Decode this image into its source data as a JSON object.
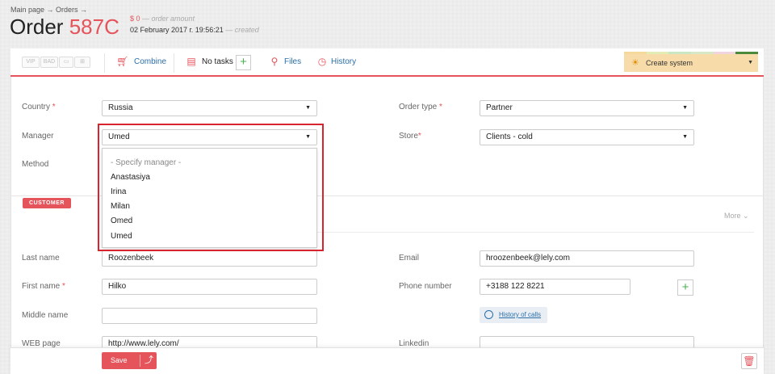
{
  "breadcrumb": "Main page → Orders →",
  "order": {
    "prefix": "Order",
    "number": "587C"
  },
  "meta": {
    "amount": "$ 0",
    "amount_label": "— order amount",
    "date": "02 February 2017 г. 19:56:21",
    "date_label": "— created"
  },
  "tags": [
    "VIP",
    "BAD"
  ],
  "toolbar": {
    "combine": "Combine",
    "tasks": "No tasks",
    "files": "Files",
    "history": "History",
    "create_system": "Create system"
  },
  "status_bar_colors": [
    "#f5d99a",
    "#e3ecb4",
    "#c9e7c2",
    "#d6e8c6",
    "#f0d4df",
    "#4a8a3a"
  ],
  "fields": {
    "country": {
      "label": "Country",
      "value": "Russia"
    },
    "manager": {
      "label": "Manager",
      "value": "Umed"
    },
    "method": {
      "label": "Method"
    },
    "order_type": {
      "label": "Order type",
      "value": "Partner"
    },
    "store": {
      "label": "Store",
      "value": "Clients - cold"
    }
  },
  "manager_options": [
    "- Specify manager -",
    "Anastasiya",
    "Irina",
    "Milan",
    "Omed",
    "Umed"
  ],
  "customer": {
    "badge": "CUSTOMER",
    "more": "More",
    "last_name": {
      "label": "Last name",
      "value": "Roozenbeek"
    },
    "first_name": {
      "label": "First name",
      "value": "Hilko"
    },
    "middle_name": {
      "label": "Middle name",
      "value": ""
    },
    "web_page": {
      "label": "WEB page",
      "value": "http://www.lely.com/"
    },
    "email": {
      "label": "Email",
      "value": "hroozenbeek@lely.com"
    },
    "phone": {
      "label": "Phone number",
      "value": "+3188 122 8221"
    },
    "history_calls": "History of calls",
    "linkedin": {
      "label": "Linkedin",
      "value": ""
    }
  },
  "footer": {
    "save": "Save"
  },
  "accent_color": "#e5535b"
}
